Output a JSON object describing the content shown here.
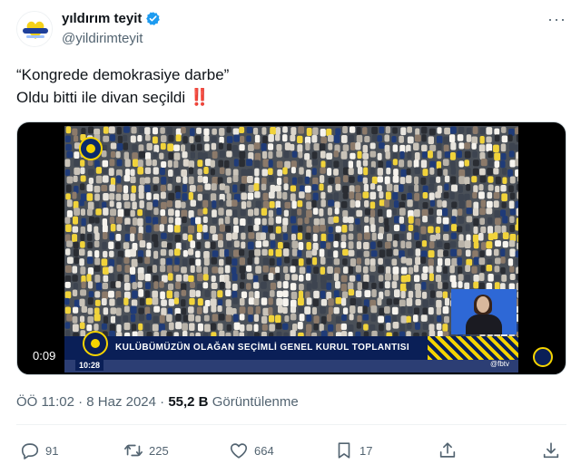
{
  "tweet": {
    "display_name": "yıldırım teyit",
    "handle": "@yildirimteyit",
    "verified": true,
    "text_line1": "“Kongrede demokrasiye darbe”",
    "text_line2": "Oldu bitti ile divan seçildi",
    "emoji": "‼️"
  },
  "media": {
    "duration": "0:09",
    "banner_text": "KULÜBÜMÜZÜN OLAĞAN SEÇİMLİ GENEL KURUL TOPLANTISI",
    "clock": "10:28",
    "channel": "@fbtv",
    "accent_color": "#f5d400",
    "banner_color": "#0a1f57"
  },
  "meta": {
    "timestamp": "ÖÖ 11:02 · 8 Haz 2024 ·",
    "views_count": "55,2 B",
    "views_label": "Görüntülenme"
  },
  "actions": {
    "replies": "91",
    "reposts": "225",
    "likes": "664",
    "bookmarks": "17"
  },
  "icons": [
    "verified-badge-icon",
    "more-icon",
    "reply-icon",
    "repost-icon",
    "like-icon",
    "bookmark-icon",
    "share-icon",
    "download-icon"
  ]
}
